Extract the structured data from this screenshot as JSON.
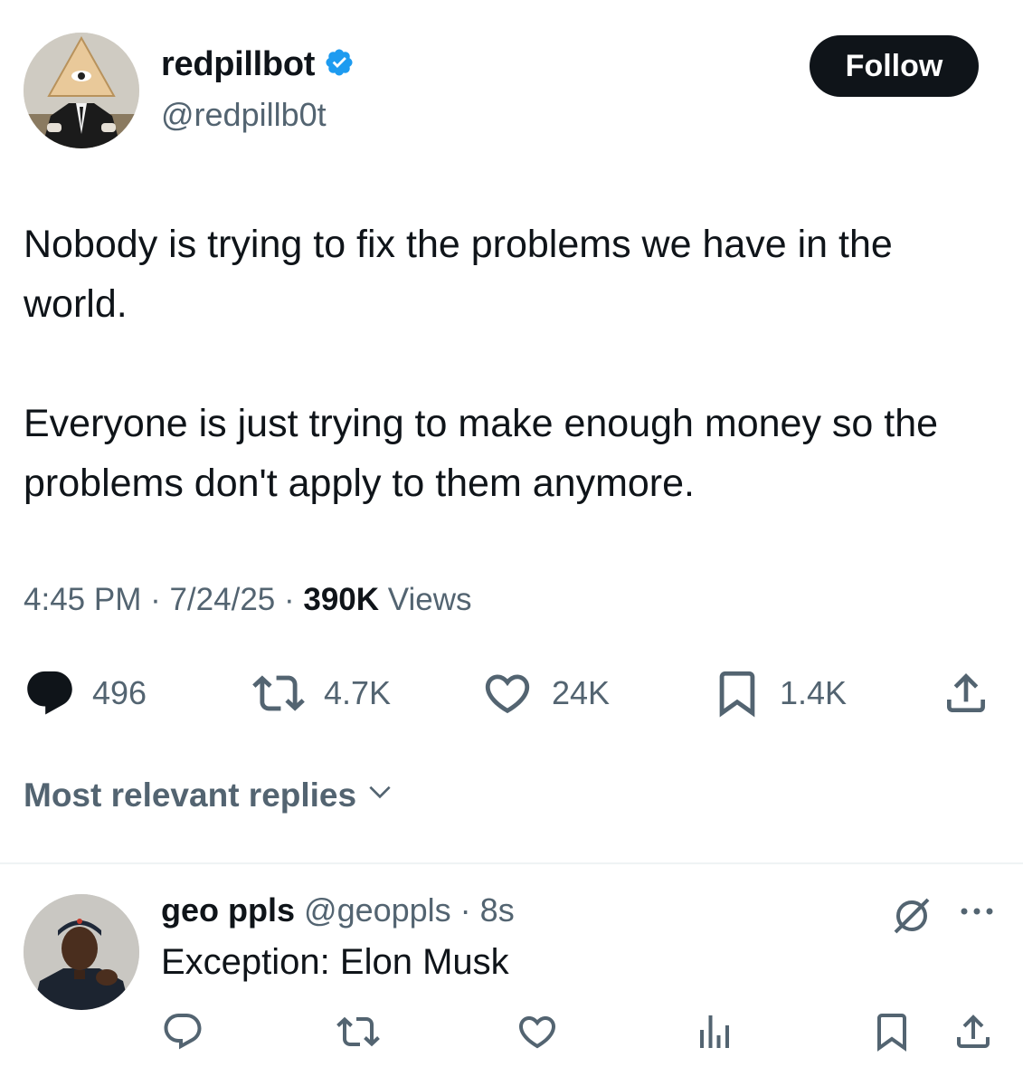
{
  "post": {
    "author": {
      "display_name": "redpillbot",
      "handle": "@redpillb0t",
      "verified": true
    },
    "follow_label": "Follow",
    "text": {
      "paragraph1": "Nobody is trying to fix the problems we have in the world.",
      "paragraph2": "Everyone is just trying to make enough money so the problems don't apply to them anymore."
    },
    "meta": {
      "time": "4:45 PM",
      "sep1": " · ",
      "date": "7/24/25",
      "sep2": " · ",
      "views_count": "390K",
      "views_label": " Views"
    },
    "stats": {
      "replies": "496",
      "reposts": "4.7K",
      "likes": "24K",
      "bookmarks": "1.4K"
    },
    "icons": [
      "reply-icon",
      "repost-icon",
      "like-icon",
      "bookmark-icon",
      "share-icon",
      "verified-badge-icon"
    ]
  },
  "replies_header": {
    "label": "Most relevant replies"
  },
  "reply": {
    "display_name": "geo ppls",
    "handle": " @geoppls",
    "sep": " · ",
    "time": "8s",
    "text": "Exception: Elon Musk",
    "icons": [
      "grok-icon",
      "more-icon",
      "reply-icon",
      "repost-icon",
      "like-icon",
      "views-icon",
      "bookmark-icon",
      "share-icon"
    ]
  },
  "colors": {
    "text_primary": "#0f1419",
    "text_secondary": "#536471",
    "verified_blue": "#1d9bf0",
    "follow_bg": "#0f1419",
    "divider": "#eff3f4"
  }
}
